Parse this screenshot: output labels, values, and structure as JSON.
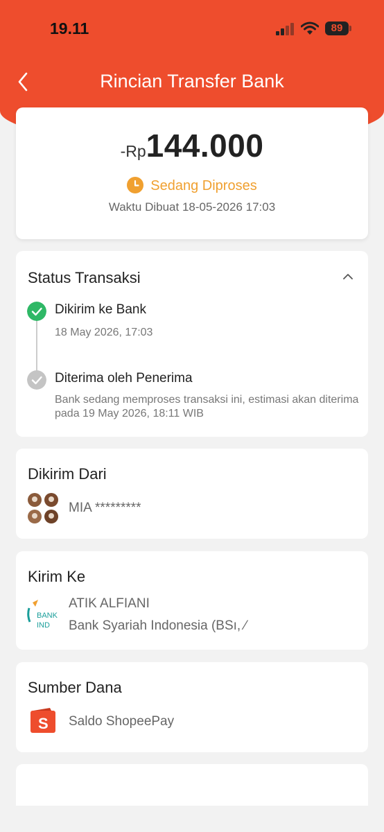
{
  "status_bar": {
    "time": "19.11",
    "battery": "89"
  },
  "nav": {
    "title": "Rincian Transfer Bank"
  },
  "summary": {
    "currency": "-Rp",
    "amount": "144.000",
    "status": "Sedang Diproses",
    "created": "Waktu Dibuat 18-05-2026 17:03"
  },
  "transaction_status": {
    "title": "Status Transaksi",
    "steps": [
      {
        "title": "Dikirim ke Bank",
        "subtitle": "18 May 2026, 17:03",
        "done": true
      },
      {
        "title": "Diterima oleh Penerima",
        "subtitle": "Bank sedang memproses transaksi ini, estimasi akan diterima pada 19 May 2026, 18:11 WIB",
        "done": false
      }
    ]
  },
  "sender": {
    "title": "Dikirim Dari",
    "name": "MIA *********"
  },
  "recipient": {
    "title": "Kirim Ke",
    "name": "ATIK ALFIANI",
    "bank": "Bank Syariah Indonesia (BSı, ⁄",
    "logo_text": "BANK IND"
  },
  "source": {
    "title": "Sumber Dana",
    "name": "Saldo ShopeePay"
  },
  "colors": {
    "brand": "#ee4d2d",
    "processing": "#f0a030",
    "done": "#2fb866",
    "pending": "#c4c4c4"
  }
}
